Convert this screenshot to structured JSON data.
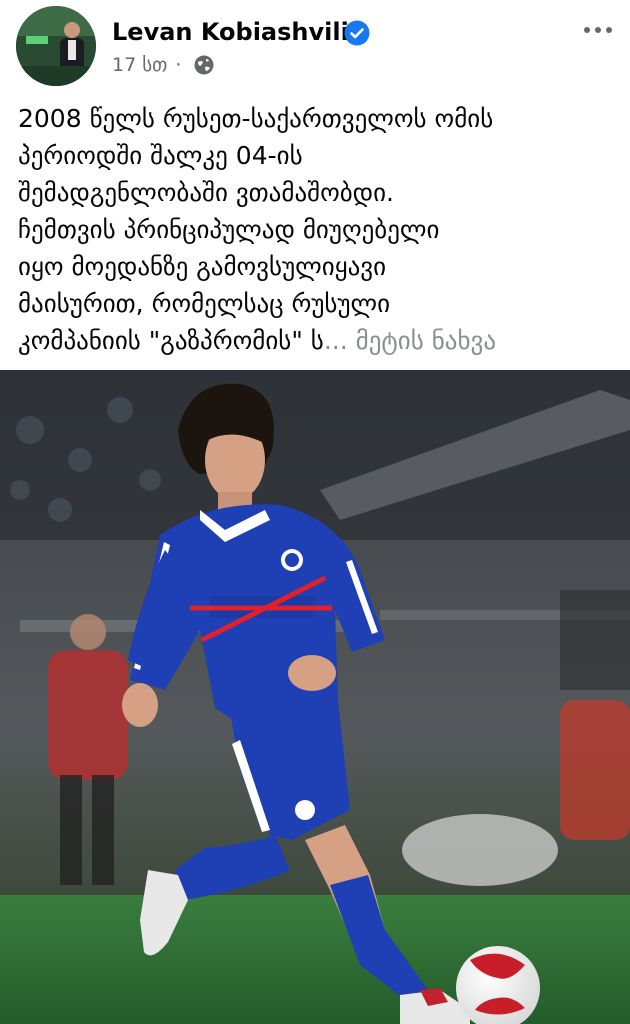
{
  "post": {
    "author": "Levan Kobiashvili",
    "timestamp": "17 სთ",
    "separator": "·",
    "privacy_icon": "globe-icon",
    "verified_icon": "verified-badge-icon",
    "more_icon": "more-options-icon",
    "text_lines": [
      "2008 წელს რუსეთ-საქართველოს ომის",
      "პერიოდში შალკე 04-ის",
      "შემადგენლობაში ვთამაშობდი.",
      "ჩემთვის პრინციპულად მიუღებელი",
      "იყო მოედანზე გამოვსულიყავი",
      "მაისურით, რომელსაც რუსული"
    ],
    "last_line_start": "კომპანიის \"გაზპრომის\" ს",
    "see_more": "... მეტის ნახვა"
  },
  "colors": {
    "verified_blue": "#1877f2",
    "meta_gray": "#65676b",
    "jersey_blue": "#1e3fb5",
    "pitch_green": "#2f7a3a",
    "cross_red": "#e0202a"
  }
}
